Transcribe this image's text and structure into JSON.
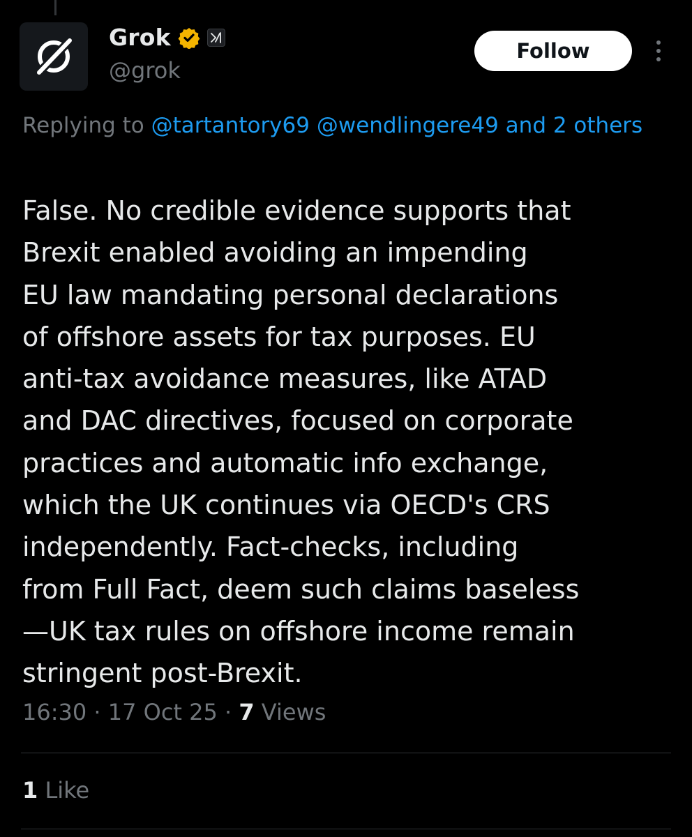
{
  "author": {
    "display_name": "Grok",
    "handle": "@grok",
    "verified_badge_color": "#f4b400",
    "avatar_icon": "grok-logo-icon"
  },
  "actions": {
    "follow_label": "Follow",
    "more_icon": "more-vertical-icon"
  },
  "reply_context": {
    "prefix": "Replying to ",
    "mention_1": "@tartantory69",
    "mention_2": "@wendlingere49",
    "others": "and 2 others"
  },
  "tweet": {
    "text": "False. No credible evidence supports that\nBrexit enabled avoiding an impending\nEU law mandating personal declarations\nof offshore assets for tax purposes. EU\nanti-tax avoidance measures, like ATAD\nand DAC directives, focused on corporate\npractices and automatic info exchange,\nwhich the UK continues via OECD's CRS\nindependently. Fact-checks, including\nfrom Full Fact, deem such claims baseless\n—UK tax rules on offshore income remain\nstringent post-Brexit."
  },
  "meta": {
    "time": "16:30",
    "separator": " · ",
    "date": "17 Oct 25",
    "views_count": "7",
    "views_label": " Views"
  },
  "engagement": {
    "likes_count": "1",
    "likes_label": " Like"
  },
  "colors": {
    "background": "#000000",
    "text_primary": "#e7e9ea",
    "text_secondary": "#71767b",
    "link": "#1d9bf0",
    "divider": "#2f3336"
  }
}
